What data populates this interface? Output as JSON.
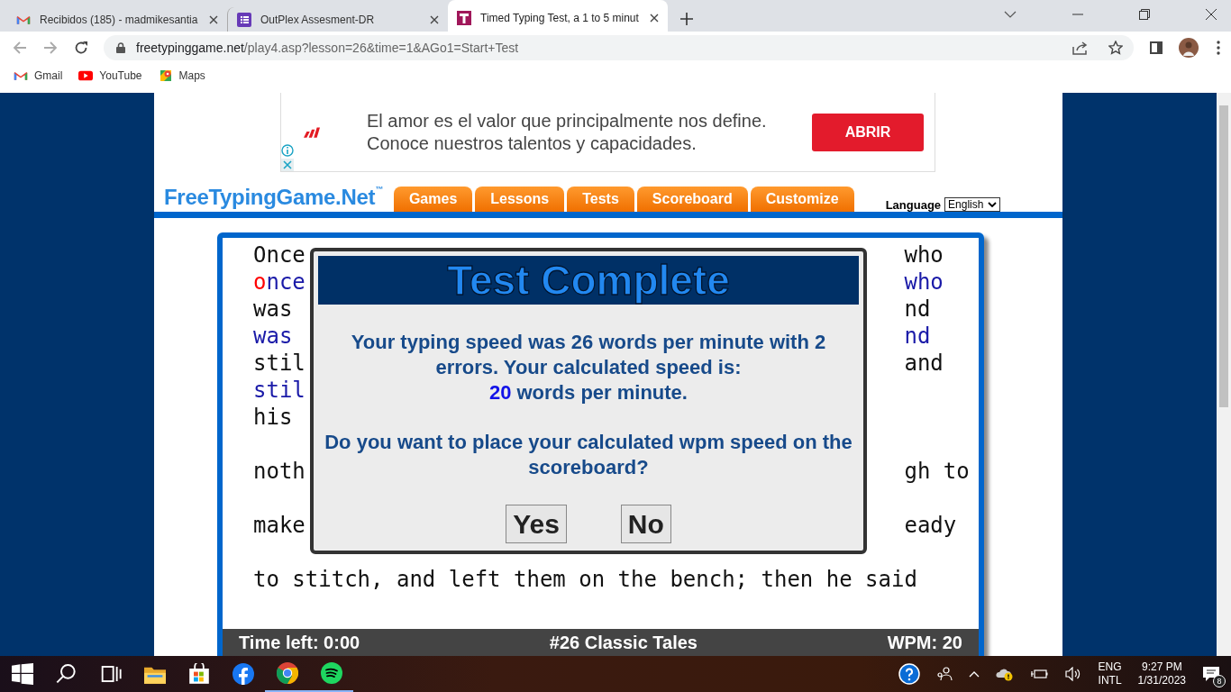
{
  "browser": {
    "tabs": [
      {
        "title": "Recibidos (185) - madmikesantia",
        "kind": "gmail",
        "selected": false
      },
      {
        "title": "OutPlex Assesment-DR",
        "kind": "forms",
        "selected": false
      },
      {
        "title": "Timed Typing Test, a 1 to 5 minut",
        "kind": "site",
        "selected": true
      }
    ],
    "url": {
      "host": "freetypinggame.net",
      "path": "/play4.asp?lesson=26&time=1&AGo1=Start+Test"
    },
    "bookmarks": [
      {
        "label": "Gmail",
        "kind": "gmail"
      },
      {
        "label": "YouTube",
        "kind": "youtube"
      },
      {
        "label": "Maps",
        "kind": "maps"
      }
    ]
  },
  "ad": {
    "lines": [
      "El amor es el valor que principalmente nos define.",
      "Conoce nuestros talentos y capacidades."
    ],
    "button": "ABRIR"
  },
  "site": {
    "logo": "FreeTypingGame.Net",
    "logo_mark": "™",
    "nav": [
      "Games",
      "Lessons",
      "Tests",
      "Scoreboard",
      "Customize"
    ],
    "language_label": "Language",
    "language_value": "English"
  },
  "passage": {
    "lines": [
      {
        "kind": "source",
        "left": [
          {
            "text": "Once",
            "error": false
          }
        ],
        "right": "who"
      },
      {
        "kind": "typed",
        "left": [
          {
            "text": "o",
            "error": true
          },
          {
            "text": "nce",
            "error": false
          }
        ],
        "right": "who"
      },
      {
        "kind": "source",
        "left": [
          {
            "text": "was",
            "error": false
          }
        ],
        "right": "nd"
      },
      {
        "kind": "typed",
        "left": [
          {
            "text": "was",
            "error": false
          }
        ],
        "right": "nd"
      },
      {
        "kind": "source",
        "left": [
          {
            "text": "stil",
            "error": false
          }
        ],
        "right": "and"
      },
      {
        "kind": "typed",
        "left": [
          {
            "text": "stil",
            "error": false
          }
        ]
      },
      {
        "kind": "source",
        "left": [
          {
            "text": "his",
            "error": false
          }
        ]
      },
      {
        "kind": "blank"
      },
      {
        "kind": "source",
        "left": [
          {
            "text": "noth",
            "error": false
          }
        ],
        "right": "gh to"
      },
      {
        "kind": "blank"
      },
      {
        "kind": "source",
        "left": [
          {
            "text": "make",
            "error": false
          }
        ],
        "right": "eady"
      },
      {
        "kind": "blank"
      },
      {
        "kind": "source",
        "left": [
          {
            "text": "to stitch, and left them on the bench; then he said",
            "error": false
          }
        ]
      }
    ]
  },
  "dialog": {
    "title": "Test Complete",
    "result": "Your typing speed was 26 words per minute with 2 errors. Your calculated speed is:",
    "calculated_value": "20",
    "calculated_unit": "words per minute.",
    "question": "Do you want to place your calculated wpm speed on the scoreboard?",
    "buttons": [
      "Yes",
      "No"
    ]
  },
  "status_bar": {
    "time_left": "Time left: 0:00",
    "lesson": "#26 Classic Tales",
    "wpm": "WPM: 20"
  },
  "taskbar": {
    "tray": {
      "language": "ENG",
      "layout": "INTL",
      "time": "9:27 PM",
      "date": "1/31/2023",
      "notifications": "8"
    }
  }
}
